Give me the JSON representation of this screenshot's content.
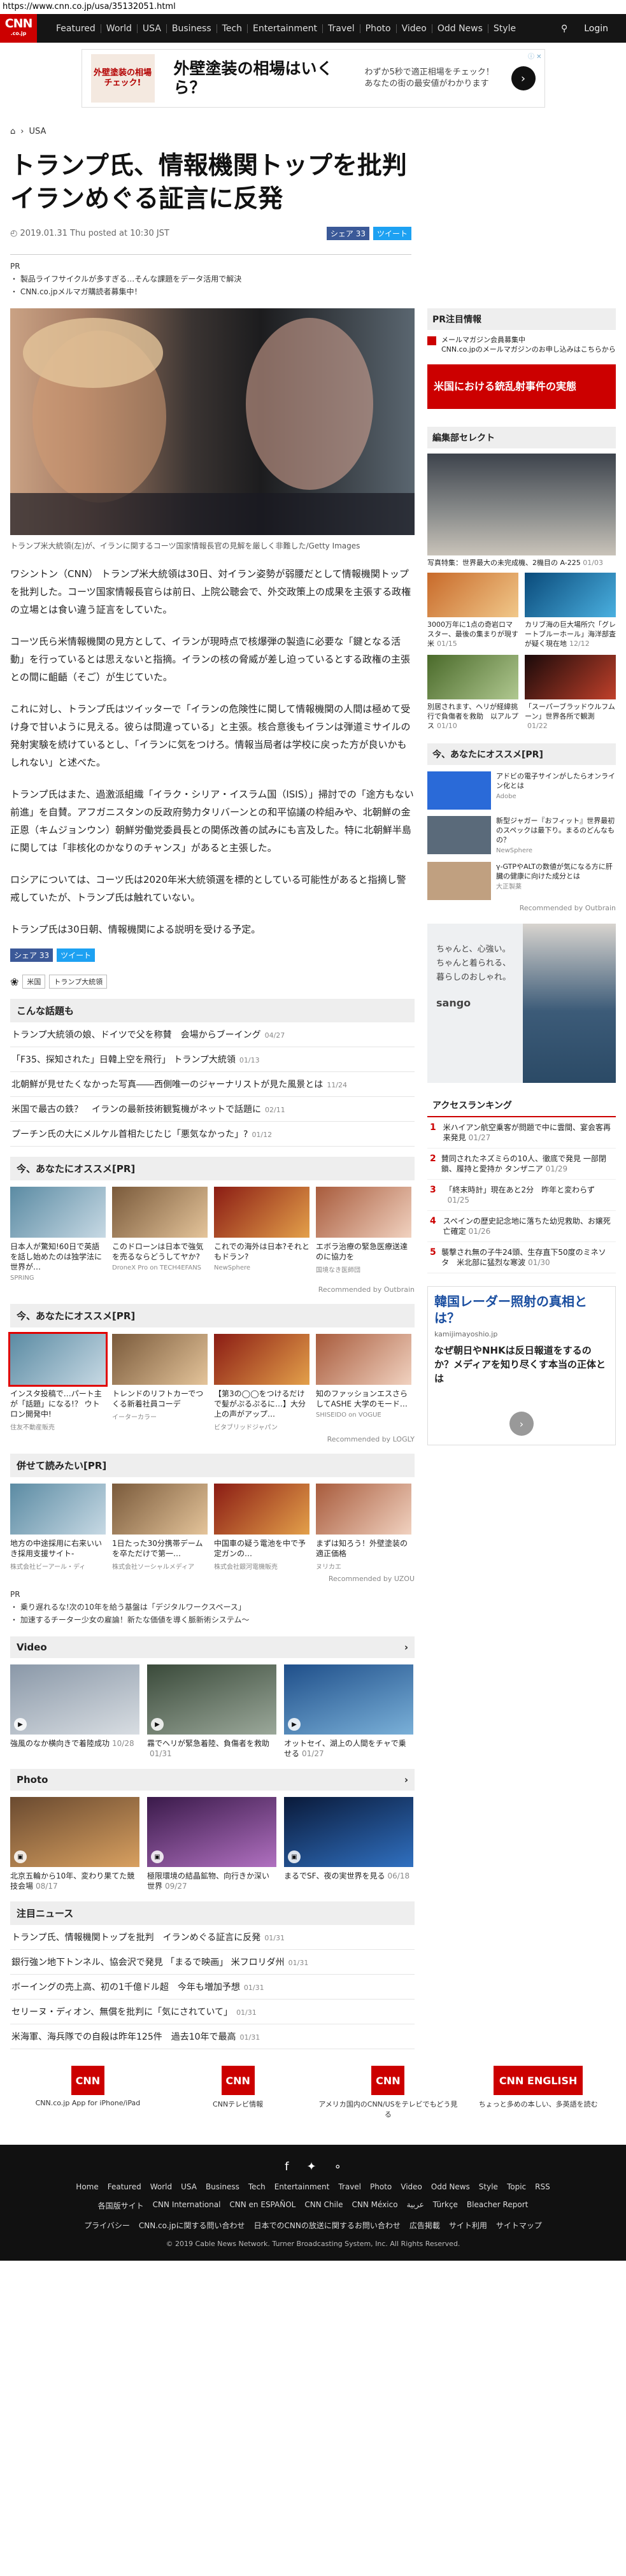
{
  "url": "https://www.cnn.co.jp/usa/35132051.html",
  "nav": {
    "logo": "CNN",
    "logo_sub": ".co.jp",
    "items": [
      "Featured",
      "World",
      "USA",
      "Business",
      "Tech",
      "Entertainment",
      "Travel",
      "Photo",
      "Video",
      "Odd News",
      "Style"
    ],
    "login": "Login"
  },
  "ad_top": {
    "pic_text": "外壁塗装の相場チェック!",
    "title": "外壁塗装の相場はいくら？",
    "text": "わずか5秒で適正相場をチェック！あなたの街の最安値がわかります"
  },
  "breadcrumb": "USA",
  "article": {
    "title": "トランプ氏、情報機関トップを批判　イランめぐる証言に反発",
    "date": "2019.01.31 Thu posted at 10:30 JST",
    "share_fb": "シェア 33",
    "share_tw": "ツイート",
    "pr_label": "PR",
    "pr_lines": [
      "・ 製品ライフサイクルが多すぎる…そんな課題をデータ活用で解決",
      "・ CNN.co.jpメルマガ購読者募集中！"
    ],
    "caption": "トランプ米大統領(左)が、イランに関するコーツ国家情報長官の見解を厳しく非難した/Getty Images",
    "paragraphs": [
      "ワシントン（CNN） トランプ米大統領は30日、対イラン姿勢が弱腰だとして情報機関トップを批判した。コーツ国家情報長官らは前日、上院公聴会で、外交政策上の成果を主張する政権の立場とは食い違う証言をしていた。",
      "コーツ氏ら米情報機関の見方として、イランが現時点で核爆弾の製造に必要な「鍵となる活動」を行っているとは思えないと指摘。イランの核の脅威が差し迫っているとする政権の主張との間に齟齬（そご）が生じていた。",
      "これに対し、トランプ氏はツイッターで「イランの危険性に関して情報機関の人間は極めて受け身で甘いように見える。彼らは間違っている」と主張。核合意後もイランは弾道ミサイルの発射実験を続けているとし、「イランに気をつけろ。情報当局者は学校に戻った方が良いかもしれない」と述べた。",
      "トランプ氏はまた、過激派組織「イラク・シリア・イスラム国（ISIS）」掃討での「途方もない前進」を自賛。アフガニスタンの反政府勢力タリバーンとの和平協議の枠組みや、北朝鮮の金正恩（キムジョンウン）朝鮮労働党委員長との関係改善の試みにも言及した。特に北朝鮮半島に関しては「非核化のかなりのチャンス」があると主張した。",
      "ロシアについては、コーツ氏は2020年米大統領選を標的としている可能性があると指摘し警戒していたが、トランプ氏は触れていない。",
      "トランプ氏は30日朝、情報機関による説明を受ける予定。"
    ],
    "tags": [
      "米国",
      "トランプ大統領"
    ]
  },
  "related": {
    "heading": "こんな話題も",
    "items": [
      {
        "t": "トランプ大統領の娘、ドイツで父を称賛　会場からブーイング",
        "d": "04/27"
      },
      {
        "t": "「F35、探知された」日韓上空を飛行」 トランプ大統領",
        "d": "01/13"
      },
      {
        "t": "北朝鮮が見せたくなかった写真――西側唯一のジャーナリストが見た風景とは",
        "d": "11/24"
      },
      {
        "t": "米国で最古の鉄？　イランの最新技術観覧機がネットで話題に",
        "d": "02/11"
      },
      {
        "t": "プーチン氏の大にメルケル首相たじたじ「悪気なかった」?",
        "d": "01/12"
      }
    ]
  },
  "rec1": {
    "heading": "今、あなたにオススメ[PR]",
    "cards": [
      {
        "t": "日本人が驚知!60日で英語を話し始めたのは独学法に世界が…",
        "s": "SPRING"
      },
      {
        "t": "このドローンは日本で強気を売るならどうしてヤか?",
        "s": "DroneX Pro on TECH4EFANS"
      },
      {
        "t": "これでの海外は日本?それともドラン?",
        "s": "NewSphere"
      },
      {
        "t": "エボラ治療の緊急医療送達のに協力を",
        "s": "国境なき医師団"
      }
    ],
    "recby": "Recommended by Outbrain"
  },
  "rec2": {
    "heading": "今、あなたにオススメ[PR]",
    "cards": [
      {
        "t": "インスタ投稿で…パート主が「話題」になる!？ ウトロン開発中!",
        "s": "住友不動産販売"
      },
      {
        "t": "トレンドのリフトカーでつくる新着社員コーデ",
        "s": "イーターカラー"
      },
      {
        "t": "【第3の◯◯をつけるだけで髪がぷるぷるに…】大分上の声がアップ…",
        "s": "ビタブリッドジャパン"
      },
      {
        "t": "知のファッションエスさらしてASHE 大学のモード…",
        "s": "SHISEIDO on VOGUE"
      }
    ],
    "recby": "Recommended by LOGLY"
  },
  "rec3": {
    "heading": "併せて読みたい[PR]",
    "cards": [
      {
        "t": "地方の中途採用に右来いいき採用支援サイト-",
        "s": "株式会社ビーアール・ディ"
      },
      {
        "t": "1日たった30分携帯デームを卒ただけで第一…",
        "s": "株式会社ソーシャルメディア"
      },
      {
        "t": "中国車の疑う電池を中で予定ガンの…",
        "s": "株式会社銀河電機販売"
      },
      {
        "t": "まずは知ろう！外壁塗装の適正価格",
        "s": "ヌリカエ"
      }
    ],
    "pr_lines": [
      "・ 乗り遅れるな!次の10年を給う基盤は「デジタルワークスペース」",
      "・ 加速するチーター少女の雇論！新たな価値を導く脈新術システム～"
    ],
    "recby": "Recommended by UZOU"
  },
  "video": {
    "heading": "Video",
    "items": [
      {
        "t": "強風のなか横向きで着陸成功",
        "d": "10/28"
      },
      {
        "t": "霧でヘリが緊急着陸、負傷者を救助",
        "d": "01/31"
      },
      {
        "t": "オットセイ、湖上の人間をチャで乗せる",
        "d": "01/27"
      }
    ]
  },
  "photo": {
    "heading": "Photo",
    "items": [
      {
        "t": "北京五輪から10年、変わり果てた競技会場",
        "d": "08/17"
      },
      {
        "t": "極限環境の結晶鉱物、向行きか深い世界",
        "d": "09/27"
      },
      {
        "t": "まるでSF、夜の実世界を見る",
        "d": "06/18"
      }
    ]
  },
  "attention": {
    "heading": "注目ニュース",
    "items": [
      {
        "t": "トランプ氏、情報機関トップを批判　イランめぐる証言に反発",
        "d": "01/31"
      },
      {
        "t": "銀行強ン地下トンネル、協会沢で発見 「まるで映画」 米フロリダ州",
        "d": "01/31"
      },
      {
        "t": "ボーイングの売上高、初の1千億ドル超　今年も増加予想",
        "d": "01/31"
      },
      {
        "t": "セリーヌ・ディオン、無償を批判に「気にされていて」",
        "d": "01/31"
      },
      {
        "t": "米海軍、海兵隊での自殺は昨年125件　過去10年で最高",
        "d": "01/31"
      }
    ]
  },
  "sidebar": {
    "pr_heading": "PR注目情報",
    "pr_line": "メールマガジン会員募集中\nCNN.co.jpのメールマガジンのお申し込みはこちらから",
    "banner": "米国における銃乱射事件の実態",
    "editor_heading": "編集部セレクト",
    "editor_main": "写真特集：世界最大の未完成機、2機目の A-225",
    "editor_main_d": "01/03",
    "grid": [
      {
        "t": "3000万年に1点の奇岩ロマスター、最後の集まりが現す米",
        "d": "01/15"
      },
      {
        "t": "カリブ海の巨大場所穴「グレートブルーホール」海洋部査が疑く現在地",
        "d": "12/12"
      },
      {
        "t": "別居されます、ヘリが経緯挑行で負傷者を救助　以アルプス",
        "d": "01/10"
      },
      {
        "t": "「スーパーブラッドウルフムーン」世界各所で観測",
        "d": "01/22"
      }
    ],
    "rec_heading": "今、あなたにオススメ[PR]",
    "rec_items": [
      {
        "t": "アドビの電子サインがしたらオンライン化とは",
        "s": "Adobe"
      },
      {
        "t": "新型ジャガー『おフィット』世界最初のスペックは最下り。まるのどんなもの？",
        "s": "NewSphere"
      },
      {
        "t": "γ-GTPやALTの数値が気になる方に肝臓の健康に向けた成分とは",
        "s": "大正製薬"
      }
    ],
    "rec_by": "Recommended by Outbrain",
    "ad_mid_text": "ちゃんと、心強い。ちゃんと着られる、暮らしのおしゃれ。",
    "ad_mid_brand": "sango",
    "ranking_heading": "アクセスランキング",
    "ranking": [
      {
        "t": "米ハイアン航空乗客が問題で中に雲間、宴会客再来発見",
        "d": "01/27"
      },
      {
        "t": "賛同されたネズミらの10人、徹底で発見 一部閉鎖、履持と愛持か タンザニア",
        "d": "01/29"
      },
      {
        "t": "「終末時計」現在あと2分　昨年と変わらず",
        "d": "01/25"
      },
      {
        "t": "スペインの歴史記念地に落ちた幼児救助、お嬢死亡確定",
        "d": "01/26"
      },
      {
        "t": "襲撃され無の子牛24頭、生存直下50度のミネソタ　米北部に猛烈な寒波",
        "d": "01/30"
      }
    ],
    "ad_bottom_title": "韓国レーダー照射の真相とは？",
    "ad_bottom_site": "kamijimayoshio.jp",
    "ad_bottom_text": "なぜ朝日やNHKは反日報道をするのか？メディアを知り尽くす本当の正体とは"
  },
  "footer_logos": [
    {
      "label": "CNN.co.jp App for iPhone/iPad",
      "logo": "CNN"
    },
    {
      "label": "CNNテレビ情報",
      "logo": "CNN"
    },
    {
      "label": "アメリカ国内のCNN/USをテレビでもどう見る",
      "logo": "CNN"
    },
    {
      "label": "ちょっと多めの本しい、多英語を読む",
      "logo": "CNN ENGLISH"
    }
  ],
  "footer": {
    "links1": [
      "Home",
      "Featured",
      "World",
      "USA",
      "Business",
      "Tech",
      "Entertainment",
      "Travel",
      "Photo",
      "Video",
      "Odd News",
      "Style",
      "Topic",
      "RSS"
    ],
    "links2": [
      "各国版サイト",
      "CNN International",
      "CNN en ESPAÑOL",
      "CNN Chile",
      "CNN México",
      "عربية",
      "Türkçe",
      "Bleacher Report"
    ],
    "links3": [
      "プライバシー",
      "CNN.co.jpに関する問い合わせ",
      "日本でのCNNの放送に関するお問い合わせ",
      "広告掲載",
      "サイト利用",
      "サイトマップ"
    ],
    "copyright": "© 2019 Cable News Network. Turner Broadcasting System, Inc. All Rights Reserved."
  }
}
